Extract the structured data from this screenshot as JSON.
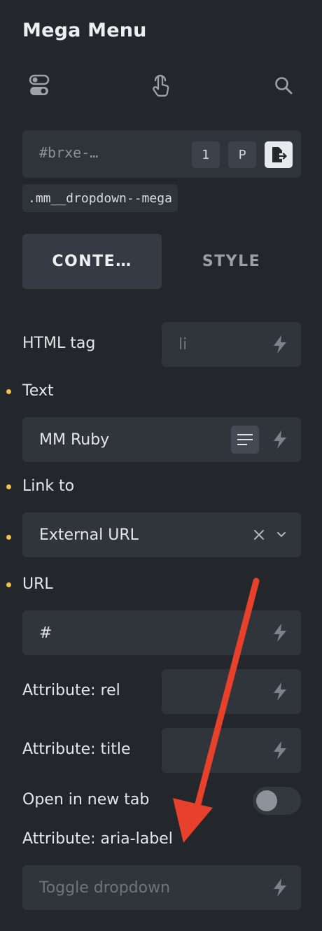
{
  "panel": {
    "title": "Mega Menu"
  },
  "toolbar": {
    "icons": [
      "toggles-icon",
      "pointer-hand-icon",
      "search-icon"
    ]
  },
  "id_box": {
    "id_text": "#brxe-…",
    "btn1": "1",
    "btnP": "P"
  },
  "class_tag": ".mm__dropdown--mega",
  "tabs": {
    "content": "CONTE…",
    "style": "STYLE"
  },
  "fields": {
    "html_tag": {
      "label": "HTML tag",
      "placeholder": "li"
    },
    "text": {
      "label": "Text",
      "value": "MM Ruby"
    },
    "link_to": {
      "label": "Link to",
      "value": "External URL"
    },
    "url": {
      "label": "URL",
      "value": "#"
    },
    "attr_rel": {
      "label": "Attribute: rel"
    },
    "attr_title": {
      "label": "Attribute: title"
    },
    "new_tab": {
      "label": "Open in new tab",
      "on": false
    },
    "aria_label": {
      "label": "Attribute: aria-label",
      "placeholder": "Toggle dropdown"
    }
  },
  "colors": {
    "background": "#23262b",
    "field": "#30343b",
    "modified_dot": "#f1c24c",
    "annotation_arrow": "#e8412b"
  }
}
